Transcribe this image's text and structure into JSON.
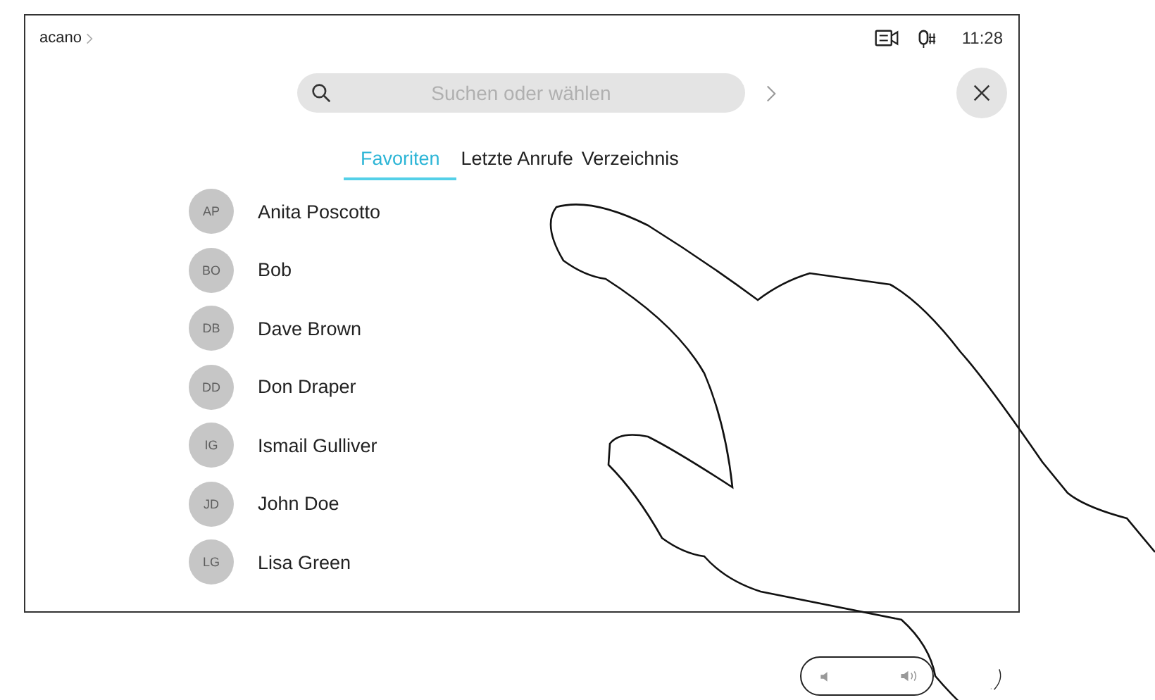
{
  "top_bar": {
    "brand": "acano",
    "time": "11:28"
  },
  "search": {
    "placeholder": "Suchen oder wählen"
  },
  "tabs": [
    {
      "label": "Favoriten",
      "selected": true
    },
    {
      "label": "Letzte Anrufe",
      "selected": false
    },
    {
      "label": "Verzeichnis",
      "selected": false
    }
  ],
  "contacts": [
    {
      "initials": "AP",
      "name": "Anita Poscotto"
    },
    {
      "initials": "BO",
      "name": "Bob"
    },
    {
      "initials": "DB",
      "name": "Dave Brown"
    },
    {
      "initials": "DD",
      "name": "Don Draper"
    },
    {
      "initials": "IG",
      "name": "Ismail Gulliver"
    },
    {
      "initials": "JD",
      "name": "John Doe"
    },
    {
      "initials": "LG",
      "name": "Lisa Green"
    }
  ]
}
